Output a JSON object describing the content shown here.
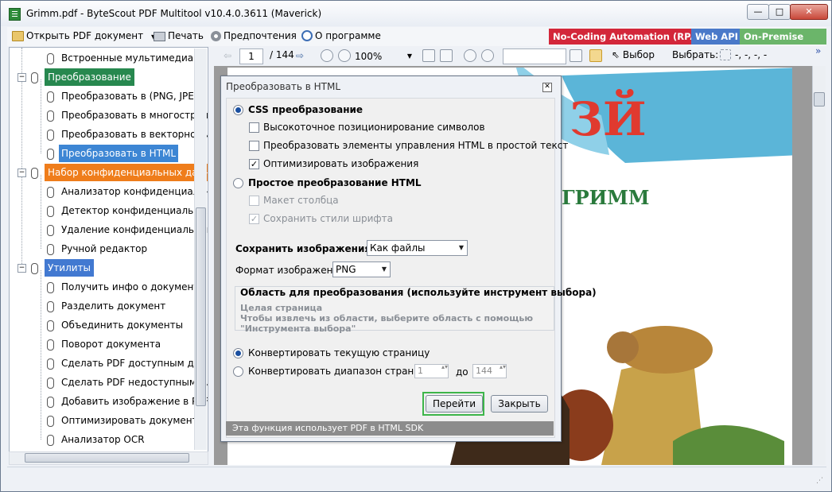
{
  "window": {
    "title": "Grimm.pdf - ByteScout PDF Multitool v10.4.0.3611 (Maverick)",
    "controls": {
      "minimize": "—",
      "maximize": "□",
      "close": "✕"
    }
  },
  "toolbar": {
    "open_label": "Открыть PDF документ",
    "print_label": "Печать",
    "preferences_label": "Предпочтения",
    "about_label": "О программе",
    "badges": [
      {
        "label": "No-Coding Automation (RPA)",
        "color": "#d3273a"
      },
      {
        "label": "Web API",
        "color": "#4a79c9"
      },
      {
        "label": "On-Premise SDK",
        "color": "#6bb56a"
      }
    ]
  },
  "sidebar": {
    "items": [
      {
        "label": "Встроенные мультимедиа"
      },
      {
        "label": "Преобразование"
      },
      {
        "label": "Преобразовать в (PNG, JPEG, ..."
      },
      {
        "label": "Преобразовать в многостраничн"
      },
      {
        "label": "Преобразовать в векторное из"
      },
      {
        "label": "Преобразовать в HTML"
      },
      {
        "label": "Набор конфиденциальных данны"
      },
      {
        "label": "Анализатор конфиденциальных"
      },
      {
        "label": "Детектор конфиденциальных д"
      },
      {
        "label": "Удаление конфиденциальных"
      },
      {
        "label": "Ручной редактор"
      },
      {
        "label": "Утилиты"
      },
      {
        "label": "Получить инфо о документе"
      },
      {
        "label": "Разделить документ"
      },
      {
        "label": "Объединить документы"
      },
      {
        "label": "Поворот документа"
      },
      {
        "label": "Сделать PDF доступным для п"
      },
      {
        "label": "Сделать PDF недоступным для"
      },
      {
        "label": "Добавить изображение в PDF"
      },
      {
        "label": "Оптимизировать документ"
      },
      {
        "label": "Анализатор OCR"
      }
    ]
  },
  "viewer": {
    "page_current": "1",
    "page_total": "/ 144",
    "zoom": "100%",
    "select_tool_label": "Выбор",
    "select_label": "Выбрать:",
    "select_coords": "-, -, -, -",
    "more": "»"
  },
  "dialog": {
    "title": "Преобразовать в HTML",
    "close": "✕",
    "css_mode_label": "CSS преобразование",
    "css_options": [
      {
        "label": "Высокоточное позиционирование символов",
        "checked": false
      },
      {
        "label": "Преобразовать элементы управления HTML в простой текст",
        "checked": false
      },
      {
        "label": "Оптимизировать изображения",
        "checked": true
      }
    ],
    "simple_mode_label": "Простое преобразование HTML",
    "simple_options": [
      {
        "label": "Макет столбца",
        "checked": false
      },
      {
        "label": "Сохранить стили шрифта",
        "checked": true
      }
    ],
    "save_images_label": "Сохранить изображения",
    "save_images_value": "Как файлы",
    "image_format_label": "Формат изображения",
    "image_format_value": "PNG",
    "area_title": "Область для преобразования (используйте инструмент выбора)",
    "area_value": "Целая страница",
    "area_hint_1": "Чтобы извлечь из области, выберите область с помощью",
    "area_hint_2": "\"Инструмента выбора\"",
    "convert_current_label": "Конвертировать текущую страницу",
    "convert_range_label": "Конвертировать диапазон страниц от",
    "range_from": "1",
    "range_to_label": "до",
    "range_to": "144",
    "go_button": "Перейти",
    "close_button": "Закрыть",
    "footer": "Эта функция использует PDF в HTML SDK"
  },
  "page_art": {
    "banner_text": "ЗЙ",
    "author_text": "ГРИММ"
  }
}
